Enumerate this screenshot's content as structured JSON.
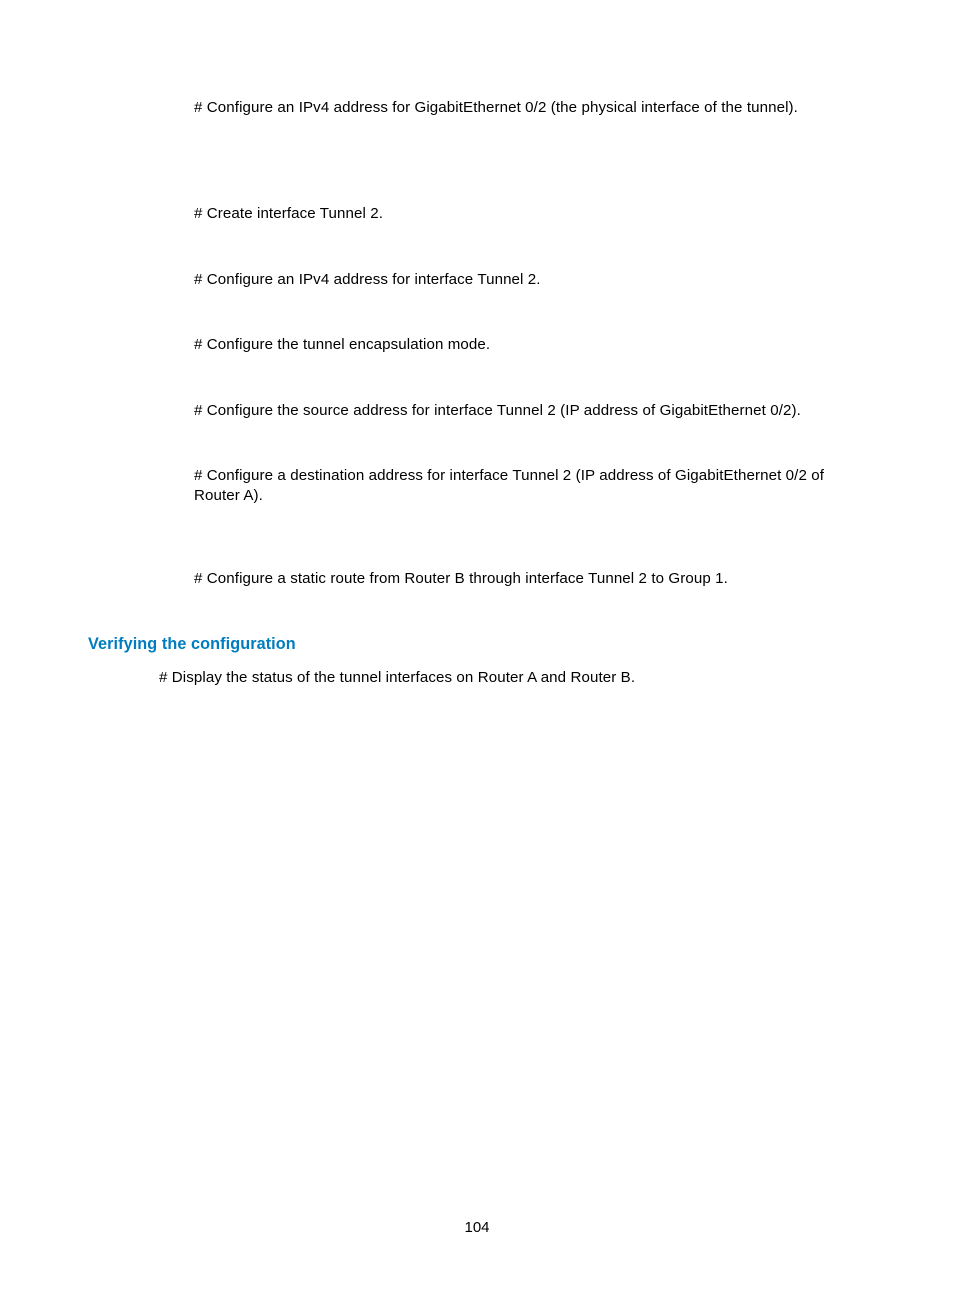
{
  "body": {
    "p1": "# Configure an IPv4 address for GigabitEthernet 0/2 (the physical interface of the tunnel).",
    "p2": "# Create interface Tunnel 2.",
    "p3": "# Configure an IPv4 address for interface Tunnel 2.",
    "p4": "# Configure the tunnel encapsulation mode.",
    "p5": "# Configure the source address for interface Tunnel 2 (IP address of GigabitEthernet 0/2).",
    "p6": "# Configure a destination address for interface Tunnel 2 (IP address of GigabitEthernet 0/2 of Router A).",
    "p7": "# Configure a static route from Router B through interface Tunnel 2 to Group 1."
  },
  "section": {
    "heading": "Verifying the configuration",
    "p1": "# Display the status of the tunnel interfaces on Router A and Router B."
  },
  "page_number": "104"
}
